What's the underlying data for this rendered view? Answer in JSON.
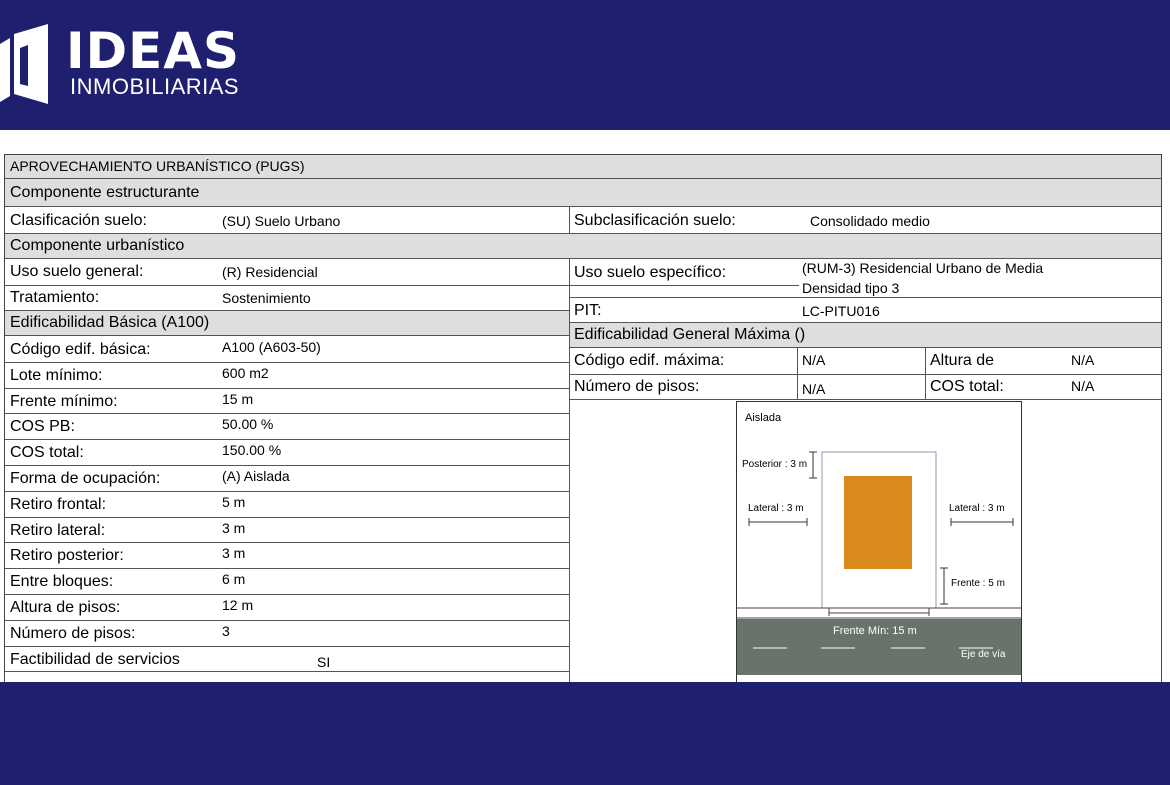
{
  "brand": {
    "name": "IDEAS",
    "subtitle": "INMOBILIARIAS",
    "color_bg": "#1e1f6e"
  },
  "doc": {
    "title": "APROVECHAMIENTO URBANÍSTICO (PUGS)",
    "comp_estructurante": "Componente  estructurante",
    "clasificacion_label": "Clasificación suelo:",
    "clasificacion_value": "(SU) Suelo Urbano",
    "subclasificacion_label": "Subclasificación suelo:",
    "subclasificacion_value": "Consolidado medio",
    "comp_urbanistico": "Componente  urbanístico",
    "uso_general_label": "Uso suelo general:",
    "uso_general_value": "(R) Residencial",
    "uso_especifico_label": "Uso suelo específico:",
    "uso_especifico_value_1": "(RUM-3) Residencial Urbano de Media",
    "uso_especifico_value_2": "Densidad tipo 3",
    "tratamiento_label": "Tratamiento:",
    "tratamiento_value": "Sostenimiento",
    "pit_label": "PIT:",
    "pit_value": "LC-PITU016",
    "edif_basica_header": "Edificabilidad Básica (A100)",
    "edif_general_header": "Edificabilidad General Máxima ()",
    "left_rows": [
      {
        "label": "Código edif. básica:",
        "value": "A100 (A603-50)"
      },
      {
        "label": "Lote mínimo:",
        "value": "600 m2"
      },
      {
        "label": "Frente mínimo:",
        "value": "15 m"
      },
      {
        "label": "COS PB:",
        "value": "50.00 %"
      },
      {
        "label": "COS total:",
        "value": "150.00 %"
      },
      {
        "label": "Forma de ocupación:",
        "value": "(A) Aislada"
      },
      {
        "label": "Retiro frontal:",
        "value": "5 m"
      },
      {
        "label": "Retiro lateral:",
        "value": "3 m"
      },
      {
        "label": "Retiro posterior:",
        "value": "3 m"
      },
      {
        "label": "Entre bloques:",
        "value": "6 m"
      },
      {
        "label": "Altura de pisos:",
        "value": "12 m"
      },
      {
        "label": "Número de pisos:",
        "value": "3"
      },
      {
        "label": "Factibilidad de servicios",
        "value": "SI"
      }
    ],
    "codigo_max_label": "Código edif. máxima:",
    "codigo_max_value": "N/A",
    "altura_de_label": "Altura de",
    "altura_de_value": "N/A",
    "num_pisos_label": "Número de pisos:",
    "num_pisos_value": "N/A",
    "cos_total_label": "COS total:",
    "cos_total_value": "N/A"
  },
  "diagram": {
    "title": "Aislada",
    "posterior": "Posterior : 3 m",
    "lateral_left": "Lateral : 3 m",
    "lateral_right": "Lateral : 3 m",
    "frente": "Frente : 5 m",
    "frente_min": "Frente Mín: 15 m",
    "eje_via": "Eje de vía",
    "building_color": "#d98a1a",
    "road_color": "#69736b"
  }
}
